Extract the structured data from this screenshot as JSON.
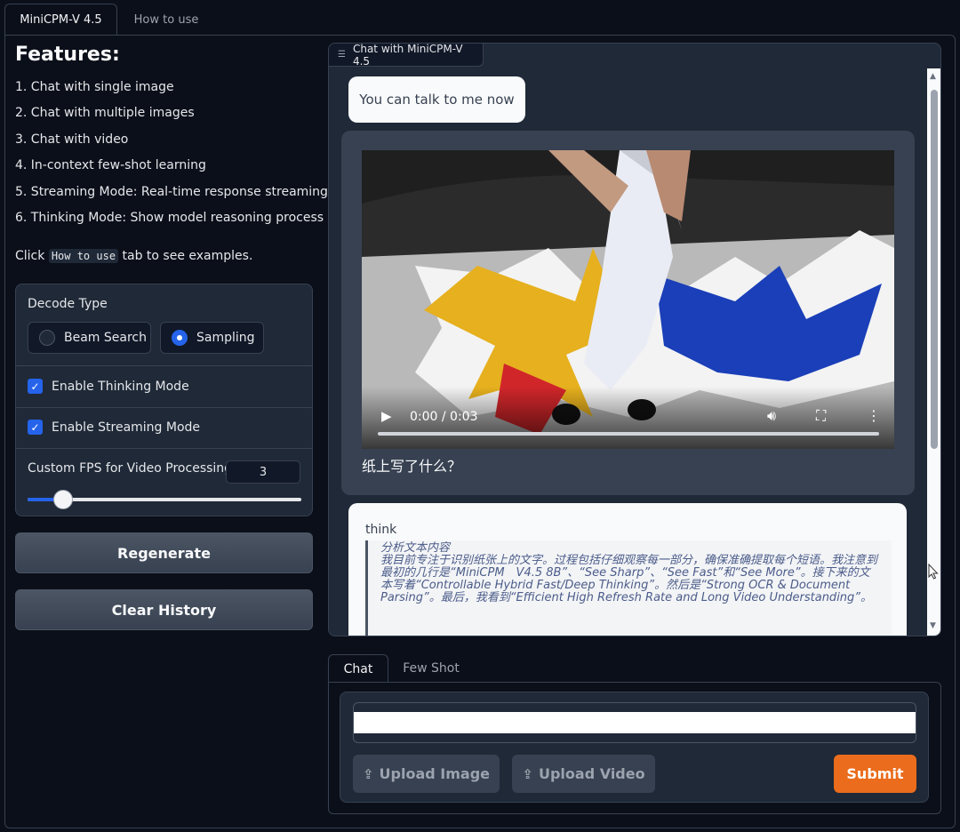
{
  "top_tabs": [
    "MiniCPM-V 4.5",
    "How to use"
  ],
  "features": {
    "title": "Features:",
    "items": [
      "1. Chat with single image",
      "2. Chat with multiple images",
      "3. Chat with video",
      "4. In-context few-shot learning",
      "5. Streaming Mode: Real-time response streaming",
      "6. Thinking Mode: Show model reasoning process"
    ],
    "hint_pre": "Click",
    "hint_code": "How to use",
    "hint_post": "tab to see examples."
  },
  "settings": {
    "decode_label": "Decode Type",
    "decode_options": [
      "Beam Search",
      "Sampling"
    ],
    "decode_selected": "Sampling",
    "thinking_label": "Enable Thinking Mode",
    "thinking_checked": true,
    "streaming_label": "Enable Streaming Mode",
    "streaming_checked": true,
    "fps_label": "Custom FPS for Video Processing",
    "fps_value": "3",
    "fps_slider_fraction": 0.13
  },
  "buttons": {
    "regenerate": "Regenerate",
    "clear": "Clear History"
  },
  "chatbot": {
    "label": "Chat with MiniCPM-V 4.5",
    "bot_greeting": "You can talk to me now",
    "video_time": "0:00 / 0:03",
    "user_question": "纸上写了什么？",
    "think_label": "think",
    "think_heading": "分析文本内容",
    "think_body": "我目前专注于识别纸张上的文字。过程包括仔细观察每一部分，确保准确提取每个短语。我注意到最初的几行是“MiniCPM　V4.5 8B”、“See Sharp”、“See Fast”和“See More”。接下来的文本写着“Controllable Hybrid Fast/Deep Thinking”。然后是“Strong OCR & Document Parsing”。最后，我看到“Efficient High Refresh Rate and Long Video Understanding”。"
  },
  "input_tabs": [
    "Chat",
    "Few Shot"
  ],
  "input": {
    "upload_image": "Upload Image",
    "upload_video": "Upload Video",
    "submit": "Submit"
  },
  "colors": {
    "accent_blue": "#2563eb",
    "submit_orange": "#ea6c1c",
    "background": "#0b0f19",
    "panel": "#1f2937"
  }
}
